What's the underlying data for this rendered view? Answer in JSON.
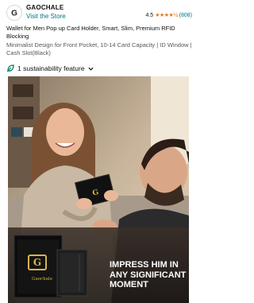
{
  "header": {
    "brand": "GAOCHALE",
    "store_link": "Visit the Store",
    "rating_value": "4.5",
    "stars": "★★★★½",
    "rating_count": "(808)",
    "logo_letter": "G"
  },
  "product": {
    "title": "Wallet for Men Pop up Card Holder, Smart, Slim, Premium RFID Blocking",
    "subtitle": "Minimalist Design for Front Pocket, 10-14 Card Capacity | ID Window | Cash Slot(Black)"
  },
  "sustainability": {
    "label": "1 sustainability feature",
    "icon": "leaf-icon",
    "accent": "#067d62"
  },
  "hero": {
    "overlay_text": "IMPRESS HIM IN ANY SIGNIFICANT MOMENT",
    "box_brand": "Gaochale"
  },
  "colors": {
    "link": "#007185",
    "star": "#de7921",
    "gold": "#d9b44a"
  }
}
